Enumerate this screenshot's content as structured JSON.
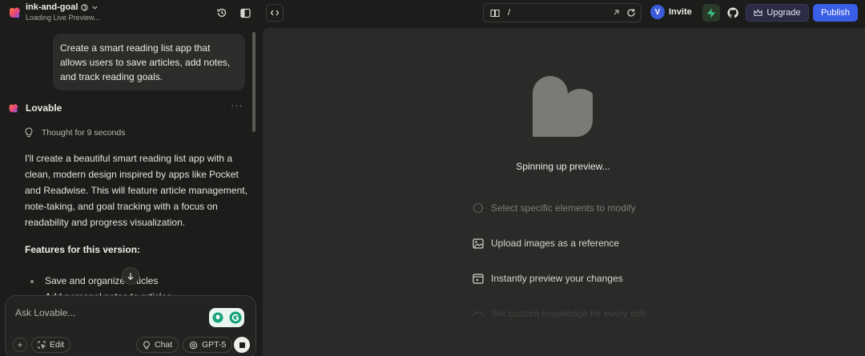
{
  "app": {
    "project_name": "ink-and-goal",
    "project_status": "Loading Live Preview..."
  },
  "topbar": {
    "url_path": "/",
    "avatar_initial": "V",
    "invite_label": "Invite",
    "upgrade_label": "Upgrade",
    "publish_label": "Publish"
  },
  "chat": {
    "user_message": "Create a smart reading list app that allows users to save articles, add notes, and track reading goals.",
    "assistant_name": "Lovable",
    "more_label": "···",
    "thought_label": "Thought for 9 seconds",
    "response_text": "I'll create a beautiful smart reading list app with a clean, modern design inspired by apps like Pocket and Readwise. This will feature article management, note-taking, and goal tracking with a focus on readability and progress visualization.",
    "features_title": "Features for this version:",
    "features": [
      "Save and organize articles",
      "Add personal notes to articles"
    ]
  },
  "composer": {
    "placeholder": "Ask Lovable...",
    "edit_label": "Edit",
    "chat_label": "Chat",
    "model_label": "GPT-5"
  },
  "preview": {
    "status_text": "Spinning up preview...",
    "tips": [
      "Select specific elements to modify",
      "Upload images as a reference",
      "Instantly preview your changes",
      "Set custom knowledge for every edit"
    ]
  },
  "colors": {
    "accent": "#3a5ee6",
    "background": "#1c1c1b",
    "preview_bg": "#2a2a29",
    "heart": "#7b7a75"
  },
  "icons": {
    "logo": "lovable-logo-icon",
    "history": "history-icon",
    "sidebar": "sidebar-toggle-icon",
    "code": "code-icon",
    "book": "book-icon",
    "external": "external-link-icon",
    "refresh": "refresh-icon",
    "bolt": "supabase-bolt-icon",
    "github": "github-icon",
    "crown": "crown-icon"
  }
}
